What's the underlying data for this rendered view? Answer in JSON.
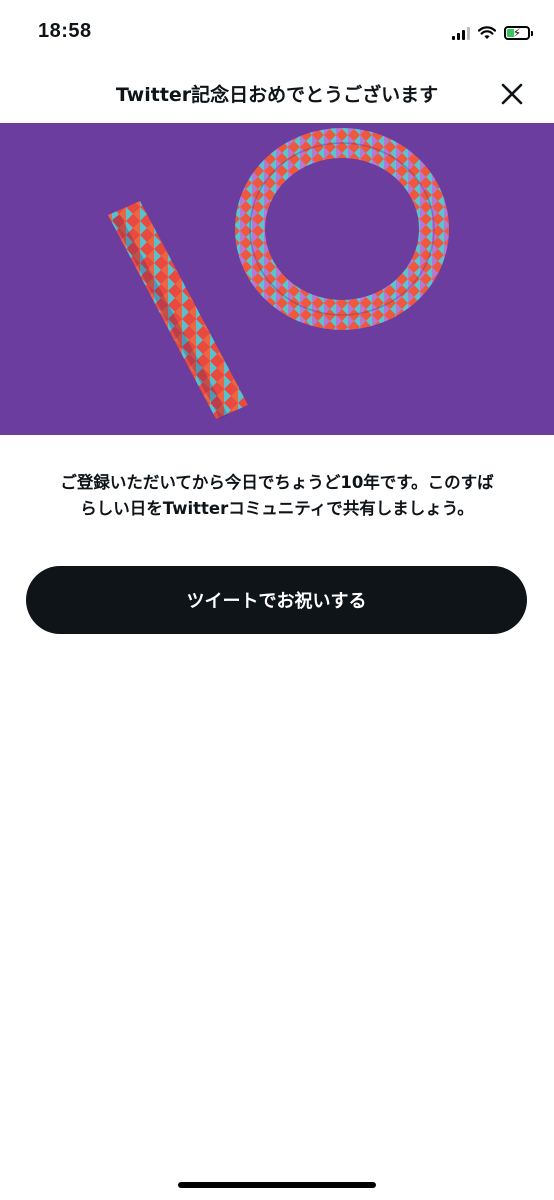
{
  "status_bar": {
    "time": "18:58",
    "icons": [
      "signal-icon",
      "wifi-icon",
      "battery-charging-icon"
    ]
  },
  "header": {
    "title": "Twitter記念日おめでとうございます",
    "close_icon": "close-icon"
  },
  "hero": {
    "image": "paper-10-anniversary-image",
    "background_color": "#6a3a9e"
  },
  "message": {
    "line1": "ご登録いただいてから今日でちょうど10年です。このすば",
    "line2": "らしい日をTwitterコミュニティで共有しましょう。"
  },
  "cta": {
    "label": "ツイートでお祝いする"
  }
}
